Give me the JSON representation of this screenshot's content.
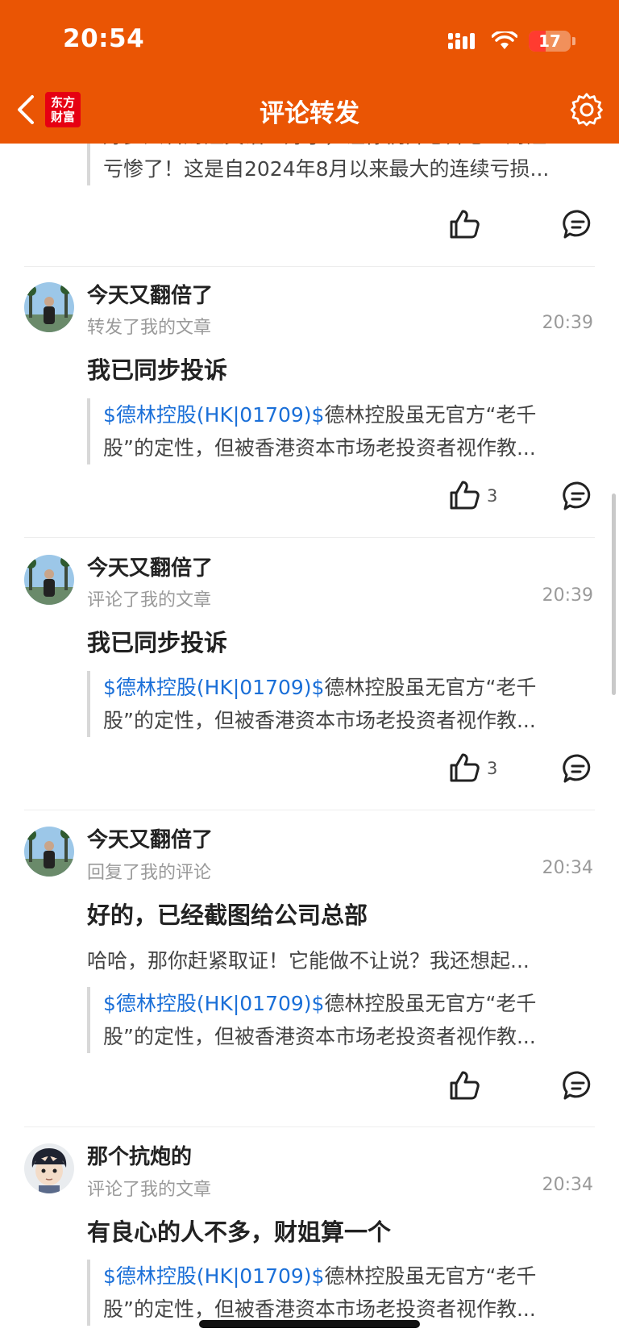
{
  "status": {
    "time": "20:54",
    "battery": "17"
  },
  "nav": {
    "title": "评论转发",
    "logo_line1": "东方",
    "logo_line2": "财富"
  },
  "top_partial": {
    "line1": "好多人看财姐笑话！好了，让你们开心开心！财姐",
    "line2": "亏惨了！这是自2024年8月以来最大的连续亏损..."
  },
  "items": [
    {
      "username": "今天又翻倍了",
      "action": "转发了我的文章",
      "time": "20:39",
      "comment": "我已同步投诉",
      "quote_link": "$德林控股(HK|01709)$",
      "quote_text": "德林控股虽无官方“老千",
      "quote_line2": "股”的定性，但被香港资本市场老投资者视作教...",
      "likes": "3"
    },
    {
      "username": "今天又翻倍了",
      "action": "评论了我的文章",
      "time": "20:39",
      "comment": "我已同步投诉",
      "quote_link": "$德林控股(HK|01709)$",
      "quote_text": "德林控股虽无官方“老千",
      "quote_line2": "股”的定性，但被香港资本市场老投资者视作教...",
      "likes": "3"
    },
    {
      "username": "今天又翻倍了",
      "action": "回复了我的评论",
      "time": "20:34",
      "comment": "好的，已经截图给公司总部",
      "reply": "哈哈，那你赶紧取证！它能做不让说？我还想起...",
      "quote_link": "$德林控股(HK|01709)$",
      "quote_text": "德林控股虽无官方“老千",
      "quote_line2": "股”的定性，但被香港资本市场老投资者视作教..."
    },
    {
      "username": "那个抗炮的",
      "action": "评论了我的文章",
      "time": "20:34",
      "comment": "有良心的人不多，财姐算一个",
      "quote_link": "$德林控股(HK|01709)$",
      "quote_text": "德林控股虽无官方“老千",
      "quote_line2": "股”的定性，但被香港资本市场老投资者视作教..."
    }
  ],
  "colors": {
    "brand": "#EA5504",
    "link": "#1a6fd8"
  },
  "icons": [
    "back-icon",
    "settings-icon",
    "like-icon",
    "comment-icon",
    "signal-icon",
    "wifi-icon",
    "battery-icon"
  ]
}
